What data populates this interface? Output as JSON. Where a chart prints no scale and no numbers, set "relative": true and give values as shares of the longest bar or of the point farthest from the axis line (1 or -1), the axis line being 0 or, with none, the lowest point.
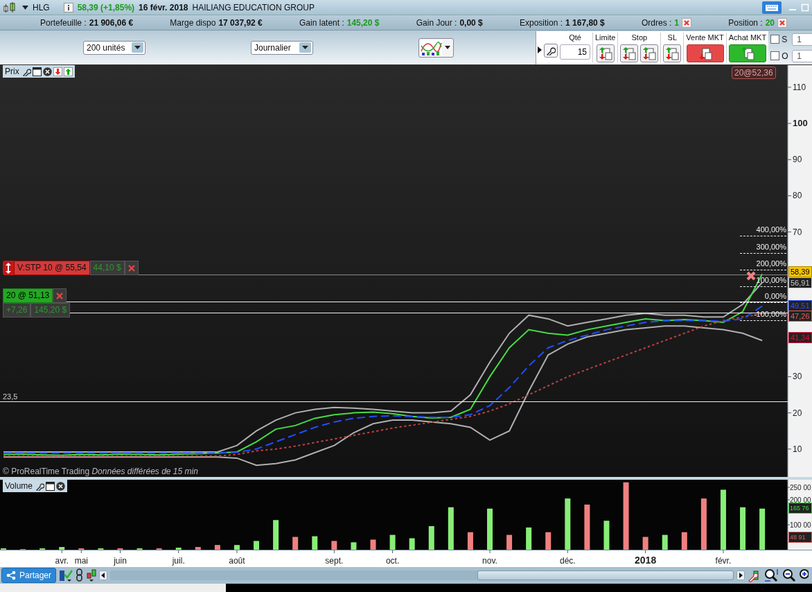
{
  "window": {
    "symbol": "HLG",
    "quote": "58,39 (+1,85%)",
    "date": "16 févr. 2018",
    "name": "HAILIANG EDUCATION GROUP"
  },
  "account_bar": [
    {
      "label": "Portefeuille :",
      "value": "21 906,06 €",
      "positive": false,
      "closable": false
    },
    {
      "label": "Marge dispo",
      "value": "17 037,92 €",
      "positive": false,
      "closable": false
    },
    {
      "label": "Gain latent :",
      "value": "145,20 $",
      "positive": true,
      "closable": false
    },
    {
      "label": "Gain Jour :",
      "value": "0,00 $",
      "positive": false,
      "closable": false
    },
    {
      "label": "Exposition :",
      "value": "1 167,80 $",
      "positive": false,
      "closable": false
    },
    {
      "label": "Ordres :",
      "value": "1",
      "positive": true,
      "closable": true
    },
    {
      "label": "Position :",
      "value": "20",
      "positive": true,
      "closable": true
    }
  ],
  "toolbar": {
    "quantity_select": "200 unités",
    "period_select": "Journalier",
    "order_panel": {
      "qty_label": "Qté",
      "qty_value": "15",
      "groups": [
        {
          "label": "Limite",
          "kind": "limit"
        },
        {
          "label": "Stop",
          "kind": "stop"
        },
        {
          "label": "SL",
          "kind": "sl"
        },
        {
          "label": "Vente MKT",
          "kind": "sell"
        },
        {
          "label": "Achat MKT",
          "kind": "buy"
        }
      ]
    },
    "options": [
      {
        "label": "S",
        "checked": false,
        "value": "1"
      },
      {
        "label": "O",
        "checked": false,
        "value": "1"
      }
    ]
  },
  "price_pane": {
    "title": "Prix",
    "position_tag": "20@52,36",
    "orders": [
      {
        "kind": "stop",
        "label": "V:STP 10 @ 55,54",
        "gain": "44,10 $"
      },
      {
        "kind": "position",
        "label": "20 @ 51,13",
        "points": "+7,26",
        "gain": "145,20 $"
      }
    ],
    "level_label": "23,5",
    "fibonacci_levels": [
      "400,00%",
      "300,00%",
      "200,00%",
      "100,00%",
      "0,00%",
      "-100,00%"
    ],
    "price_tags": [
      {
        "label": "58,39",
        "color": "#f5c400",
        "highlight": true
      },
      {
        "label": "56,91",
        "color": "#c8c8c8",
        "highlight": false
      },
      {
        "label": "49,51",
        "color": "#3050ff",
        "highlight": false
      },
      {
        "label": "47,26",
        "color": "#e06060",
        "highlight": false
      },
      {
        "label": "41,34",
        "color": "#e0103a",
        "highlight": false
      }
    ],
    "footer": "© ProRealTime Trading *Données différées de 15 min*",
    "chart_data": {
      "type": "line",
      "ylim": [
        2.3,
        116.1
      ],
      "categories": [
        null,
        null,
        null,
        null,
        null,
        null,
        null,
        null,
        null,
        null,
        null,
        null,
        null,
        null,
        null,
        null,
        null,
        null,
        null,
        null,
        null,
        null,
        null,
        null,
        null,
        null,
        null,
        null,
        null,
        null,
        null,
        null,
        null,
        null,
        null,
        null,
        null,
        null,
        null,
        null
      ],
      "yticks": [
        10,
        20,
        30,
        70,
        80,
        90,
        100,
        110
      ],
      "series": [
        {
          "color": "#b0b0b0",
          "values": [
            9.2,
            9.2,
            9.2,
            9.2,
            9.2,
            9.2,
            9.2,
            9.2,
            9.2,
            9.2,
            9.2,
            9.2,
            11,
            15,
            18,
            20,
            21,
            21.5,
            21.3,
            21,
            20.5,
            20,
            20,
            20.5,
            25,
            34,
            42,
            47,
            46,
            44,
            45,
            46,
            47,
            47.5,
            47,
            47,
            46.5,
            46.5,
            50,
            56
          ]
        },
        {
          "color": "#b0b0b0",
          "values": [
            7.8,
            7.8,
            7.8,
            7.8,
            7.8,
            7.8,
            7.8,
            7.8,
            7.8,
            7.8,
            7.8,
            7.8,
            7.5,
            5.5,
            6,
            7,
            9,
            11,
            14.5,
            17,
            18,
            18,
            17.5,
            17,
            16,
            12.5,
            15,
            26,
            36,
            39,
            41,
            42,
            43,
            43.5,
            44,
            44,
            43.5,
            43,
            42,
            40
          ]
        },
        {
          "color": "#c04040",
          "line_style": "dotted",
          "values": [
            8.1,
            8.1,
            8.1,
            8.1,
            8.1,
            8.1,
            8.1,
            8.1,
            8.1,
            8.1,
            8.1,
            8.1,
            8.5,
            9.5,
            10,
            10.8,
            11.8,
            12.8,
            13.8,
            14.8,
            15.8,
            16.6,
            17.4,
            18.2,
            19,
            20.5,
            22.5,
            25,
            27.5,
            30,
            32,
            34,
            36,
            38,
            40,
            42,
            44,
            45.5,
            46.5,
            47.3
          ]
        },
        {
          "color": "#1f4fff",
          "line_style": "dashed",
          "values": [
            8.9,
            8.9,
            8.9,
            8.9,
            8.9,
            8.9,
            8.9,
            8.9,
            8.9,
            8.9,
            8.9,
            8.9,
            9.1,
            10,
            12,
            14,
            16,
            17.5,
            18.5,
            19,
            19.2,
            19,
            18.8,
            18.8,
            19.5,
            22,
            27,
            33,
            38,
            40,
            41.5,
            43,
            44,
            45,
            45.5,
            45.5,
            45.5,
            45.3,
            46,
            49.5
          ]
        },
        {
          "color": "#44dd44",
          "values": [
            8.5,
            8.6,
            8.4,
            8.3,
            8.5,
            8.4,
            8.6,
            8.5,
            8.4,
            8.6,
            8.7,
            8.9,
            9.2,
            12,
            15.5,
            16.5,
            18.5,
            19.5,
            20,
            20.2,
            19.8,
            19,
            18.6,
            18.8,
            21,
            30,
            38,
            43,
            42,
            41.5,
            43,
            44,
            45,
            46,
            45.5,
            45.8,
            45.5,
            45,
            48,
            58.4
          ]
        }
      ]
    }
  },
  "volume_pane": {
    "title": "Volume",
    "volume_tags": [
      {
        "label": "165 76",
        "color": "#44dd44"
      },
      {
        "label": "48 91",
        "color": "#e06060"
      }
    ],
    "axis_labels": [
      "250 00",
      "200 00",
      "100 00"
    ],
    "chart_data": {
      "type": "bar",
      "stacked": true,
      "relative": true,
      "categories": [
        null,
        null,
        null,
        "avr.",
        "mai",
        null,
        "juin",
        null,
        null,
        "juil.",
        null,
        null,
        "août",
        null,
        null,
        null,
        null,
        "sept.",
        null,
        null,
        "oct.",
        null,
        null,
        null,
        null,
        "nov.",
        null,
        null,
        null,
        "déc.",
        null,
        null,
        null,
        "2018",
        null,
        null,
        null,
        "févr.",
        null,
        null
      ],
      "series": [
        {
          "color": "#88ee77",
          "values": [
            0.02,
            null,
            0.02,
            0.04,
            null,
            0.02,
            null,
            0.02,
            null,
            0.03,
            null,
            null,
            0.07,
            0.13,
            0.44,
            null,
            0.2,
            null,
            0.11,
            null,
            0.22,
            0.17,
            0.35,
            0.63,
            null,
            0.61,
            null,
            0.33,
            null,
            0.76,
            null,
            0.43,
            null,
            null,
            0.22,
            null,
            null,
            0.89,
            0.63,
            0.61
          ]
        },
        {
          "color": "#f08080",
          "values": [
            null,
            0.01,
            null,
            null,
            0.02,
            null,
            0.02,
            null,
            0.02,
            null,
            0.04,
            0.07,
            null,
            null,
            null,
            0.19,
            null,
            0.13,
            null,
            0.15,
            null,
            null,
            null,
            null,
            0.26,
            null,
            0.22,
            null,
            0.26,
            null,
            0.67,
            null,
            1,
            0.19,
            null,
            0.26,
            0.76,
            null,
            null,
            null
          ]
        }
      ]
    }
  },
  "bottom_bar": {
    "share_button": "Partager"
  }
}
